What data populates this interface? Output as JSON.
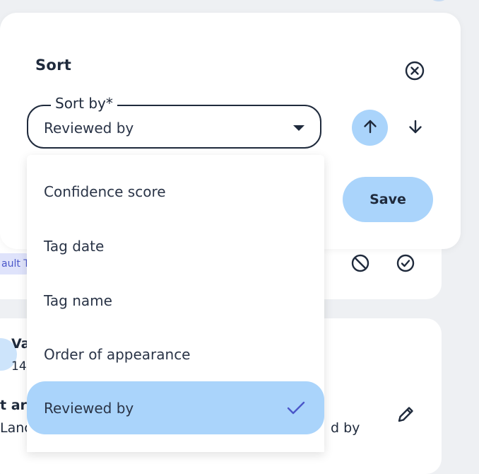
{
  "dialog": {
    "title": "Sort",
    "sort_field": {
      "label": "Sort by*",
      "value": "Reviewed by"
    },
    "save_label": "Save",
    "icons": {
      "close": "close-circle-icon",
      "ascending": "arrow-up-icon",
      "descending": "arrow-down-icon",
      "caret": "caret-down-icon"
    }
  },
  "menu": {
    "items": [
      {
        "label": "Confidence score",
        "selected": false
      },
      {
        "label": "Tag date",
        "selected": false
      },
      {
        "label": "Tag name",
        "selected": false
      },
      {
        "label": "Order of appearance",
        "selected": false
      },
      {
        "label": "Reviewed by",
        "selected": true
      }
    ]
  },
  "background": {
    "tag": "ault T",
    "card2": {
      "name": "Va",
      "sub": "14",
      "bold": "t ar",
      "lang": "Lanc",
      "by": "d by"
    }
  },
  "colors": {
    "accent": "#aad4fb",
    "text": "#1f2a3c",
    "check": "#4b57c9"
  }
}
